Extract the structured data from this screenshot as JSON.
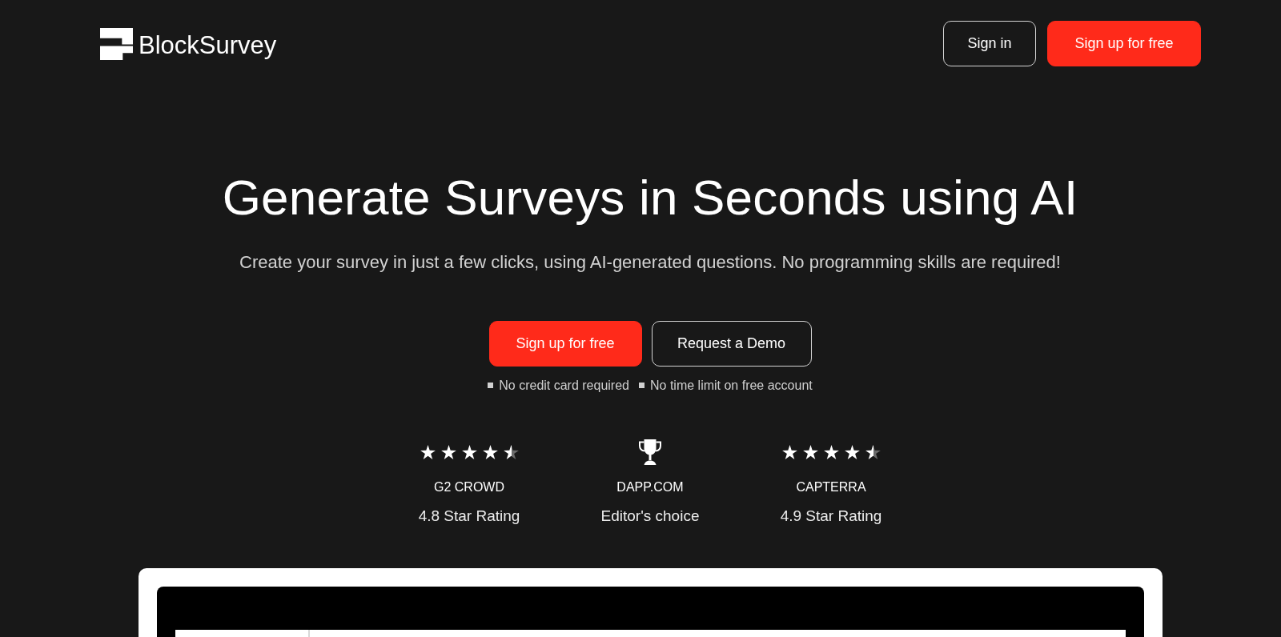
{
  "header": {
    "logo_text": "BlockSurvey",
    "buttons": [
      {
        "kind": "outline",
        "label": "Sign in"
      },
      {
        "kind": "primary",
        "label": "Sign up for free"
      }
    ]
  },
  "hero": {
    "title": "Generate Surveys in Seconds using AI",
    "subtitle": "Create your survey in just a few clicks, using AI-generated questions. No programming skills are required!",
    "buttons": [
      {
        "kind": "primary",
        "label": "Sign up for free"
      },
      {
        "kind": "outline",
        "label": "Request a Demo"
      }
    ],
    "notes": [
      "No credit card required",
      "No time limit on free account"
    ]
  },
  "ratings": [
    {
      "kind": "stars",
      "stars": 4.5,
      "source": "G2 CROWD",
      "text": "4.8 Star Rating"
    },
    {
      "kind": "award",
      "source": "DAPP.COM",
      "text": "Editor's choice"
    },
    {
      "kind": "stars",
      "stars": 4.5,
      "source": "CAPTERRA",
      "text": "4.9 Star Rating"
    }
  ]
}
